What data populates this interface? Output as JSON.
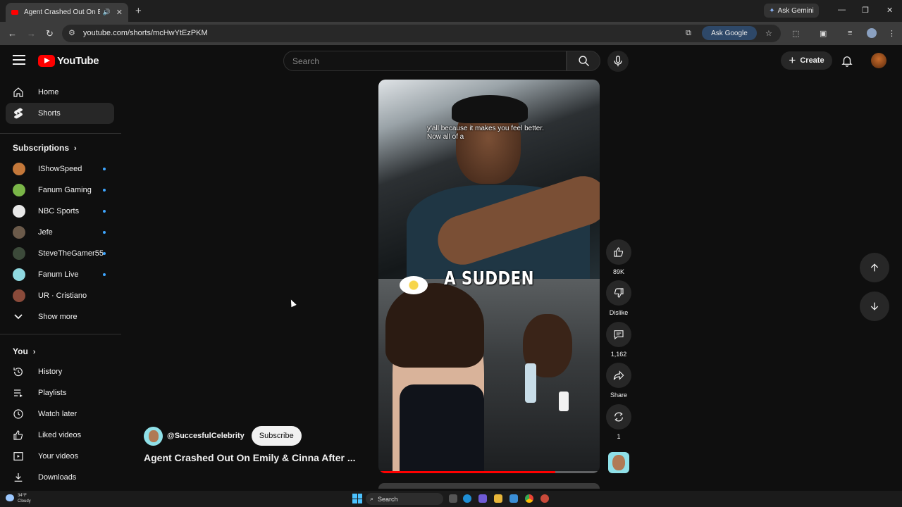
{
  "browser": {
    "tab_title": "Agent Crashed Out On Emily & Cinna After ... - YouTube",
    "new_tab_icon": "+",
    "ask_gemini": "Ask Gemini",
    "url": "youtube.com/shorts/mcHwYtEzPKM",
    "ask_google": "Ask Google"
  },
  "header": {
    "logo_text": "YouTube",
    "search_placeholder": "Search",
    "create_label": "Create"
  },
  "sidebar": {
    "main": [
      {
        "label": "Home",
        "icon": "home-icon"
      },
      {
        "label": "Shorts",
        "icon": "shorts-icon"
      }
    ],
    "subscriptions_heading": "Subscriptions",
    "subscriptions": [
      {
        "label": "IShowSpeed",
        "color": "#c4783a"
      },
      {
        "label": "Fanum Gaming",
        "color": "#7ab648"
      },
      {
        "label": "NBC Sports",
        "color": "#e8e8e8"
      },
      {
        "label": "Jefe",
        "color": "#6b5a4a"
      },
      {
        "label": "SteveTheGamer55",
        "color": "#3c4a3a"
      },
      {
        "label": "Fanum Live",
        "color": "#8fd8e0"
      },
      {
        "label": "UR · Cristiano",
        "color": "#8a4a3a"
      }
    ],
    "show_more": "Show more",
    "you_heading": "You",
    "you_items": [
      {
        "label": "History"
      },
      {
        "label": "Playlists"
      },
      {
        "label": "Watch later"
      },
      {
        "label": "Liked videos"
      },
      {
        "label": "Your videos"
      },
      {
        "label": "Downloads"
      }
    ]
  },
  "short": {
    "subtitle_line1": "y'all because it makes you feel better.",
    "subtitle_line2": "Now all of a",
    "caption": "A SUDDEN",
    "progress": 0.8,
    "channel": "@SuccesfulCelebrity",
    "subscribe_label": "Subscribe",
    "title": "Agent Crashed Out On Emily & Cinna After ..."
  },
  "actions": {
    "like_count": "89K",
    "dislike_label": "Dislike",
    "comment_count": "1,162",
    "share_label": "Share",
    "remix_count": "1"
  },
  "taskbar": {
    "weather_temp": "34°F",
    "weather_desc": "Cloudy",
    "search_label": "Search"
  }
}
